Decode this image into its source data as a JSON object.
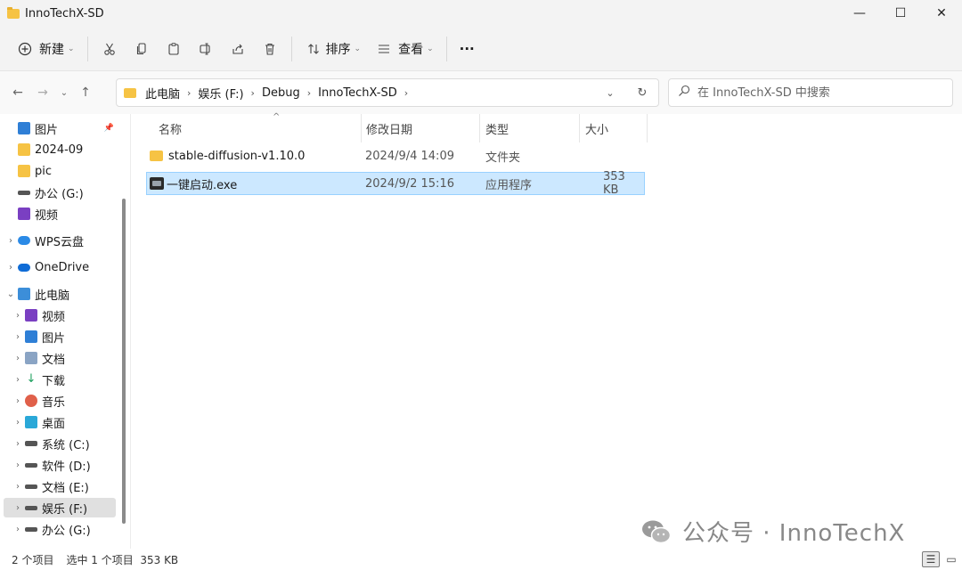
{
  "window": {
    "title": "InnoTechX-SD",
    "minimize": "—",
    "maximize": "☐",
    "close": "✕"
  },
  "toolbar": {
    "new_label": "新建",
    "sort_label": "排序",
    "view_label": "查看",
    "more_label": "···"
  },
  "address": {
    "crumbs": [
      "此电脑",
      "娱乐 (F:)",
      "Debug",
      "InnoTechX-SD"
    ]
  },
  "search": {
    "placeholder": "在 InnoTechX-SD 中搜索"
  },
  "sidebar": {
    "items": [
      {
        "label": "图片",
        "pinned": true
      },
      {
        "label": "2024-09"
      },
      {
        "label": "pic"
      },
      {
        "label": "办公 (G:)"
      },
      {
        "label": "视频"
      },
      {
        "label": "WPS云盘"
      },
      {
        "label": "OneDrive"
      },
      {
        "label": "此电脑"
      },
      {
        "label": "视频"
      },
      {
        "label": "图片"
      },
      {
        "label": "文档"
      },
      {
        "label": "下载"
      },
      {
        "label": "音乐"
      },
      {
        "label": "桌面"
      },
      {
        "label": "系统 (C:)"
      },
      {
        "label": "软件 (D:)"
      },
      {
        "label": "文档 (E:)"
      },
      {
        "label": "娱乐 (F:)"
      },
      {
        "label": "办公 (G:)"
      }
    ]
  },
  "columns": {
    "name": "名称",
    "modified": "修改日期",
    "type": "类型",
    "size": "大小"
  },
  "files": [
    {
      "name": "stable-diffusion-v1.10.0",
      "modified": "2024/9/4 14:09",
      "type": "文件夹",
      "size": ""
    },
    {
      "name": "一键启动.exe",
      "modified": "2024/9/2 15:16",
      "type": "应用程序",
      "size": "353 KB"
    }
  ],
  "status": {
    "count": "2 个项目",
    "selection": "选中 1 个项目  353 KB"
  },
  "watermark": {
    "text": "公众号 · InnoTechX"
  },
  "colors": {
    "folder": "#f6c344",
    "selection": "#cce8ff",
    "selection_border": "#99d1ff"
  }
}
